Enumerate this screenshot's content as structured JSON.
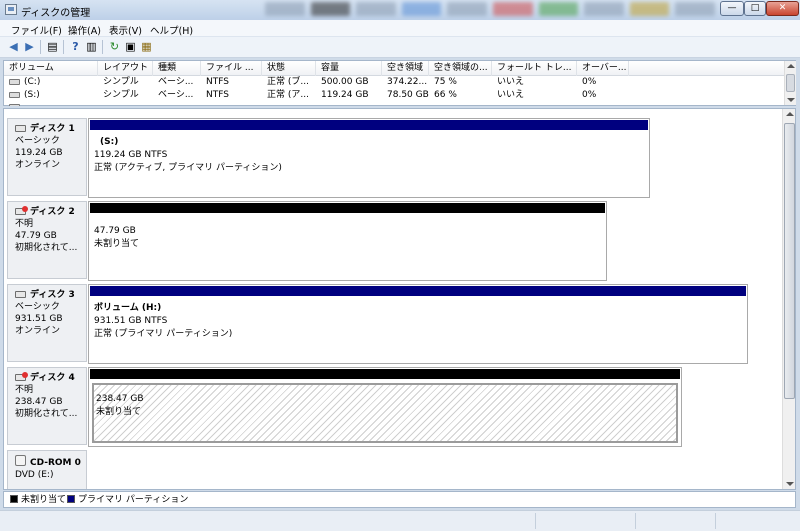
{
  "window": {
    "title": "ディスクの管理"
  },
  "menu": [
    "ファイル(F)",
    "操作(A)",
    "表示(V)",
    "ヘルプ(H)"
  ],
  "toolbar": {
    "icons": [
      "back-arrow-icon",
      "forward-arrow-icon",
      "console-tree-icon",
      "help-icon",
      "show-hide-action-pane-icon",
      "refresh-icon",
      "properties-icon",
      "export-list-icon"
    ]
  },
  "volume_list": {
    "columns": [
      "ボリューム",
      "レイアウト",
      "種類",
      "ファイル ...",
      "状態",
      "容量",
      "空き領域",
      "空き領域の...",
      "フォールト トレ...",
      "オーバー..."
    ],
    "rows": [
      [
        "(C:)",
        "シンプル",
        "ベーシ...",
        "NTFS",
        "正常 (ブ...",
        "500.00 GB",
        "374.22...",
        "75 %",
        "いいえ",
        "0%"
      ],
      [
        "(S:)",
        "シンプル",
        "ベーシ...",
        "NTFS",
        "正常 (ア...",
        "119.24 GB",
        "78.50 GB",
        "66 %",
        "いいえ",
        "0%"
      ]
    ]
  },
  "disks": [
    {
      "name": "ディスク 1",
      "type": "ベーシック",
      "size": "119.24 GB",
      "status": "オンライン",
      "partition": {
        "label": "(S:)",
        "size_fs": "119.24 GB NTFS",
        "status": "正常 (アクティブ, プライマリ パーティション)"
      }
    },
    {
      "name": "ディスク 2",
      "type": "不明",
      "size": "47.79 GB",
      "status": "初期化されて...",
      "partition": {
        "size": "47.79 GB",
        "status": "未割り当て"
      }
    },
    {
      "name": "ディスク 3",
      "type": "ベーシック",
      "size": "931.51 GB",
      "status": "オンライン",
      "partition": {
        "label": "ボリューム (H:)",
        "size_fs": "931.51 GB NTFS",
        "status": "正常 (プライマリ パーティション)"
      }
    },
    {
      "name": "ディスク 4",
      "type": "不明",
      "size": "238.47 GB",
      "status": "初期化されて...",
      "partition": {
        "size": "238.47 GB",
        "status": "未割り当て"
      }
    },
    {
      "name": "CD-ROM 0",
      "type": "DVD (E:)"
    }
  ],
  "legend": [
    {
      "label": "未割り当て",
      "color": "#000000"
    },
    {
      "label": "プライマリ パーティション",
      "color": "#00007f"
    }
  ],
  "colors": {
    "primary_partition_bar": "#00007f",
    "unallocated_bar": "#000000"
  }
}
